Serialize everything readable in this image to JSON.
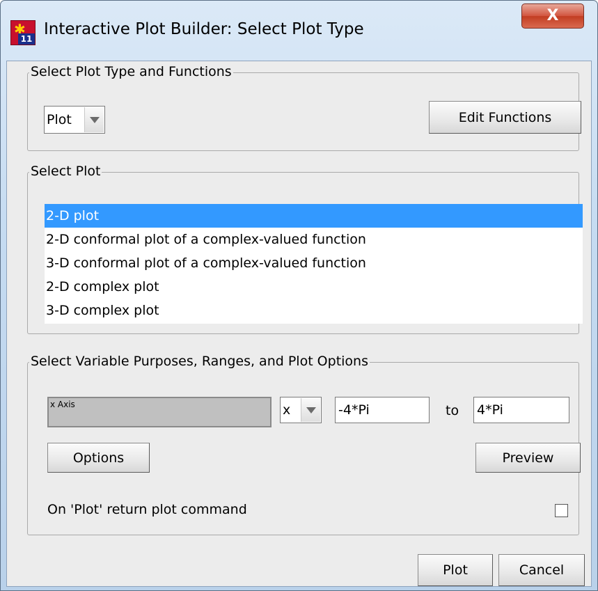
{
  "window": {
    "title": "Interactive Plot Builder: Select Plot Type",
    "app_icon_badge": "11",
    "close_glyph": "X"
  },
  "type_group": {
    "legend": "Select Plot Type and Functions",
    "plot_type_selected": "Plot",
    "edit_functions_label": "Edit Functions"
  },
  "plot_group": {
    "legend": "Select Plot",
    "items": [
      "2-D plot",
      "2-D conformal plot of a complex-valued function",
      "3-D conformal plot of a complex-valued function",
      "2-D complex plot",
      "3-D complex plot"
    ],
    "selected_index": 0
  },
  "vars_group": {
    "legend": "Select Variable Purposes, Ranges, and Plot Options",
    "axis_label": "x Axis",
    "variable_selected": "x",
    "range_from": "-4*Pi",
    "to_label": "to",
    "range_to": "4*Pi",
    "options_label": "Options",
    "preview_label": "Preview",
    "return_command_label": "On 'Plot' return plot command",
    "return_command_checked": false
  },
  "footer": {
    "plot_label": "Plot",
    "cancel_label": "Cancel"
  },
  "colors": {
    "selection": "#3399ff",
    "close_button": "#c23d22",
    "dialog_bg": "#ececec"
  }
}
